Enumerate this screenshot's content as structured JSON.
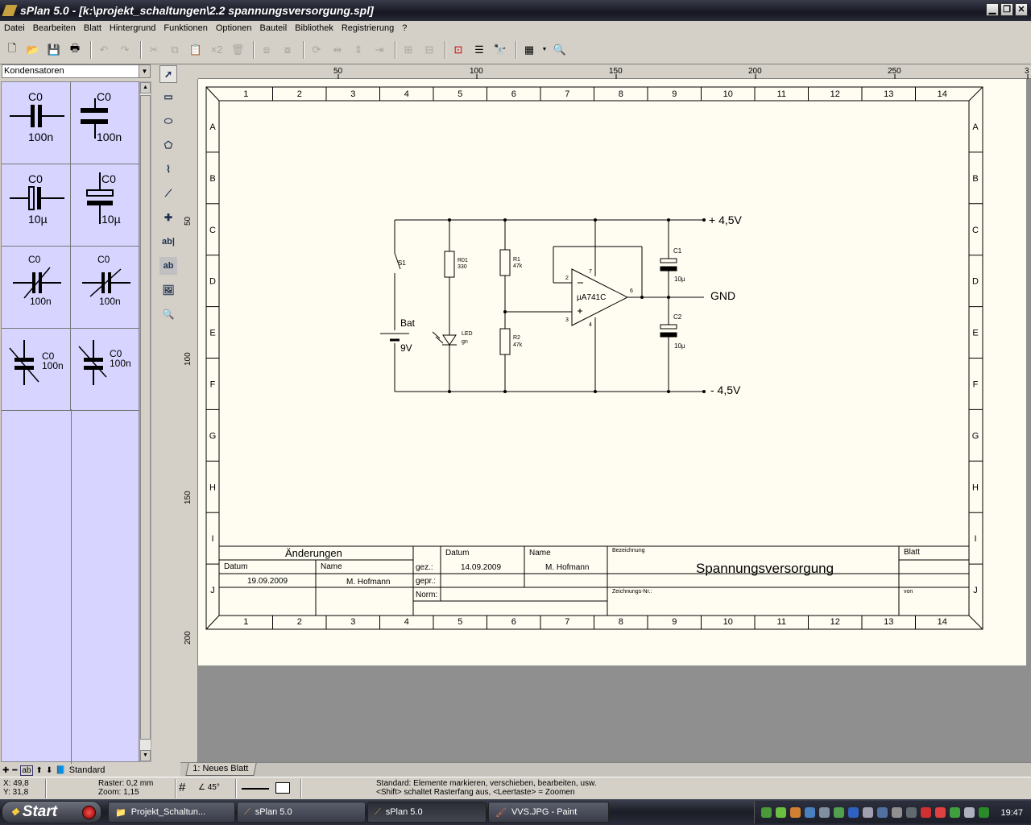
{
  "window": {
    "title": "sPlan 5.0 - [k:\\projekt_schaltungen\\2.2 spannungsversorgung.spl]"
  },
  "menu": [
    "Datei",
    "Bearbeiten",
    "Blatt",
    "Hintergrund",
    "Funktionen",
    "Optionen",
    "Bauteil",
    "Bibliothek",
    "Registrierung",
    "?"
  ],
  "library": {
    "category": "Kondensatoren",
    "items": [
      {
        "name": "C0",
        "value": "100n"
      },
      {
        "name": "C0",
        "value": "100n"
      },
      {
        "name": "C0",
        "value": "10µ"
      },
      {
        "name": "C0",
        "value": "10µ"
      },
      {
        "name": "C0",
        "value": "100n"
      },
      {
        "name": "C0",
        "value": "100n"
      },
      {
        "name": "C0",
        "value": "100n"
      },
      {
        "name": "C0",
        "value": "100n"
      }
    ],
    "footer_label": "Standard"
  },
  "rulers": {
    "h": [
      "50",
      "100",
      "150",
      "200",
      "250",
      "3"
    ],
    "v": [
      "50",
      "100",
      "150",
      "200"
    ]
  },
  "sheet": {
    "cols": [
      "1",
      "2",
      "3",
      "4",
      "5",
      "6",
      "7",
      "8",
      "9",
      "10",
      "11",
      "12",
      "13",
      "14"
    ],
    "rows": [
      "A",
      "B",
      "C",
      "D",
      "E",
      "F",
      "G",
      "H",
      "I",
      "J"
    ]
  },
  "schematic": {
    "vplus": "+ 4,5V",
    "vminus": "- 4,5V",
    "gnd": "GND",
    "s1": "S1",
    "bat": "Bat",
    "bat_v": "9V",
    "r01": "R01",
    "r01_v": "330",
    "led": "LED",
    "led_v": "gn",
    "r1": "R1",
    "r1_v": "47k",
    "r2": "R2",
    "r2_v": "47k",
    "opamp": "µA741C",
    "pin2": "2",
    "pin3": "3",
    "pin4": "4",
    "pin6": "6",
    "pin7": "7",
    "c1": "C1",
    "c1_v": "10µ",
    "c2": "C2",
    "c2_v": "10µ"
  },
  "titleblock": {
    "changes": "Änderungen",
    "datum": "Datum",
    "name": "Name",
    "change_date": "19.09.2009",
    "change_name": "M. Hofmann",
    "gez": "gez.:",
    "gepr": "gepr.:",
    "norm": "Norm:",
    "datum2": "Datum",
    "name2": "Name",
    "date": "14.09.2009",
    "author": "M. Hofmann",
    "bez_label": "Bezeichnung",
    "bezeichnung": "Spannungsversorgung",
    "zeichnr_label": "Zeichnungs-Nr.:",
    "blatt": "Blatt",
    "von": "von"
  },
  "tab": "1: Neues Blatt",
  "status": {
    "x": "X: 49,8",
    "y": "Y: 31,8",
    "raster": "Raster: 0,2 mm",
    "zoom": "Zoom:   1,15",
    "angle": "45°",
    "hint1": "Standard: Elemente markieren, verschieben, bearbeiten, usw.",
    "hint2": "<Shift> schaltet Rasterfang aus, <Leertaste> = Zoomen"
  },
  "taskbar": {
    "start": "Start",
    "tasks": [
      "Projekt_Schaltun...",
      "sPlan 5.0",
      "sPlan 5.0",
      "VVS.JPG - Paint"
    ],
    "clock": "19:47"
  }
}
